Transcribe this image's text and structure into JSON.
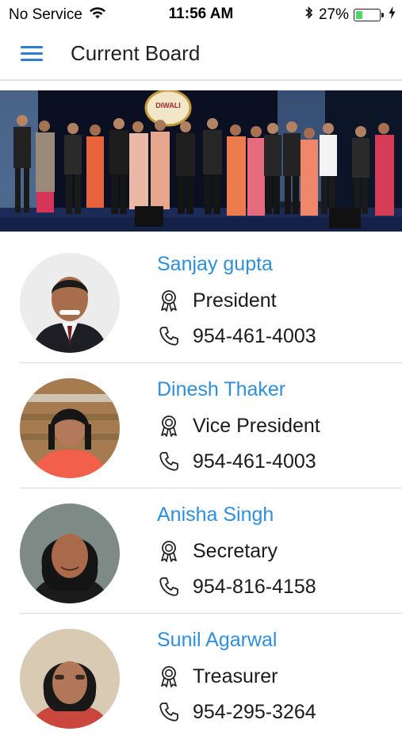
{
  "status_bar": {
    "carrier": "No Service",
    "time": "11:56 AM",
    "battery": "27%",
    "battery_level": 0.27,
    "icons": [
      "wifi-icon",
      "bluetooth-icon",
      "battery-icon",
      "charging-bolt-icon"
    ]
  },
  "navbar": {
    "title": "Current Board",
    "menu_icon": "hamburger-menu-icon",
    "accent_color": "#2f7fd6"
  },
  "banner": {
    "description_icon": "group-photo",
    "sign_text": "DIWALI"
  },
  "colors": {
    "name_link": "#2f8fdc",
    "divider": "#d9d9d9"
  },
  "members": [
    {
      "name": "Sanjay gupta",
      "role": "President",
      "phone": "954-461-4003"
    },
    {
      "name": "Dinesh Thaker",
      "role": "Vice President",
      "phone": "954-461-4003"
    },
    {
      "name": "Anisha Singh",
      "role": "Secretary",
      "phone": "954-816-4158"
    },
    {
      "name": "Sunil Agarwal",
      "role": "Treasurer",
      "phone": "954-295-3264"
    }
  ]
}
